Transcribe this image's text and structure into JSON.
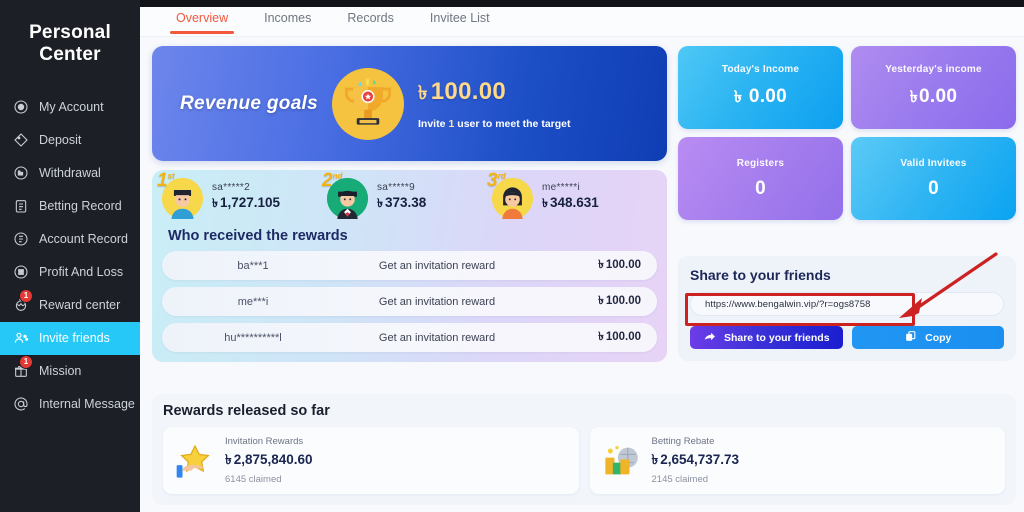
{
  "sidebar": {
    "title": "Personal Center",
    "items": [
      {
        "label": "My Account",
        "icon": "account-icon",
        "badge": null
      },
      {
        "label": "Deposit",
        "icon": "deposit-icon",
        "badge": null
      },
      {
        "label": "Withdrawal",
        "icon": "withdrawal-icon",
        "badge": null
      },
      {
        "label": "Betting Record",
        "icon": "clipboard-icon",
        "badge": null
      },
      {
        "label": "Account Record",
        "icon": "list-icon",
        "badge": null
      },
      {
        "label": "Profit And Loss",
        "icon": "chart-icon",
        "badge": null
      },
      {
        "label": "Reward center",
        "icon": "gift-ball-icon",
        "badge": "1"
      },
      {
        "label": "Invite friends",
        "icon": "friends-icon",
        "badge": null
      },
      {
        "label": "Mission",
        "icon": "mission-gift-icon",
        "badge": "1"
      },
      {
        "label": "Internal Message",
        "icon": "at-icon",
        "badge": null
      }
    ],
    "active_index": 7
  },
  "tabs": [
    {
      "label": "Overview"
    },
    {
      "label": "Incomes"
    },
    {
      "label": "Records"
    },
    {
      "label": "Invitee List"
    }
  ],
  "active_tab": 0,
  "banner": {
    "title": "Revenue goals",
    "currency": "৳",
    "amount": "100.00",
    "sub_prefix": "Invite",
    "sub_count": "1",
    "sub_suffix": "user to meet the target",
    "icon": "trophy-icon"
  },
  "leaderboard": {
    "heading": "Who received the rewards",
    "top": [
      {
        "rank": "1",
        "rank_suffix": "st",
        "name": "sa*****2",
        "currency": "৳",
        "amount": "1,727.105",
        "avatar_color": "#f7d84b"
      },
      {
        "rank": "2",
        "rank_suffix": "nd",
        "name": "sa*****9",
        "currency": "৳",
        "amount": "373.38",
        "avatar_color": "#17ab77"
      },
      {
        "rank": "3",
        "rank_suffix": "rd",
        "name": "me*****i",
        "currency": "৳",
        "amount": "348.631",
        "avatar_color": "#f7d84b"
      }
    ],
    "rows": [
      {
        "name": "ba***1",
        "desc": "Get an invitation reward",
        "currency": "৳",
        "amount": "100.00"
      },
      {
        "name": "me***i",
        "desc": "Get an invitation reward",
        "currency": "৳",
        "amount": "100.00"
      },
      {
        "name": "hu**********l",
        "desc": "Get an invitation reward",
        "currency": "৳",
        "amount": "100.00"
      }
    ]
  },
  "released": {
    "heading": "Rewards released so far",
    "cards": [
      {
        "label": "Invitation Rewards",
        "currency": "৳",
        "amount": "2,875,840.60",
        "claimed": "6145 claimed",
        "icon": "star-hand-icon"
      },
      {
        "label": "Betting Rebate",
        "currency": "৳",
        "amount": "2,654,737.73",
        "claimed": "2145 claimed",
        "icon": "money-globe-icon"
      }
    ]
  },
  "stats": [
    {
      "label": "Today's Income",
      "currency": "৳",
      "value": "0.00",
      "color": "#1fb2f2"
    },
    {
      "label": "Yesterday's income",
      "currency": "৳",
      "value": "0.00",
      "color": "#9a7bee"
    },
    {
      "label": "Registers",
      "currency": "",
      "value": "0",
      "color": "#a37ced"
    },
    {
      "label": "Valid Invitees",
      "currency": "",
      "value": "0",
      "color": "#30b5f3"
    }
  ],
  "share": {
    "heading": "Share to your friends",
    "url": "https://www.bengalwin.vip/?r=ogs8758",
    "share_button": "Share to your friends",
    "copy_button": "Copy",
    "share_icon": "share-arrow-icon",
    "copy_icon": "copy-icon"
  },
  "annotation": {
    "highlight_color": "#cc2222",
    "arrow_icon": "pointer-arrow-icon"
  }
}
